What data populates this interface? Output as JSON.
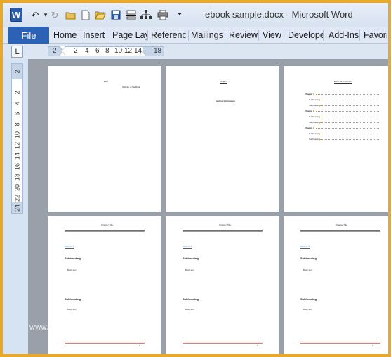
{
  "window": {
    "title": "ebook sample.docx  -  Microsoft Word",
    "app_icon_letter": "W",
    "accent_color": "#2c62b5",
    "border_color": "#e8a82a"
  },
  "quick_access": [
    {
      "name": "undo-icon",
      "glyph": "↶"
    },
    {
      "name": "undo-dropdown-icon",
      "glyph": "▾"
    },
    {
      "name": "redo-icon",
      "glyph": "↻"
    },
    {
      "name": "open-folder-icon",
      "glyph": "📂"
    },
    {
      "name": "new-document-icon",
      "glyph": "🗋"
    },
    {
      "name": "open-icon",
      "glyph": "📁"
    },
    {
      "name": "save-icon",
      "glyph": "💾"
    },
    {
      "name": "page-break-icon",
      "glyph": "▬"
    },
    {
      "name": "sitemap-icon",
      "glyph": "品"
    },
    {
      "name": "print-icon",
      "glyph": "🖶"
    },
    {
      "name": "customize-toolbar-icon",
      "glyph": "⏷"
    }
  ],
  "ribbon": {
    "file_label": "File",
    "tabs": [
      "Home",
      "Insert",
      "Page Lay",
      "Referenc",
      "Mailings",
      "Review",
      "View",
      "Develope",
      "Add-Ins",
      "Favori"
    ]
  },
  "ruler": {
    "tab_selector": "L",
    "h_numbers": [
      "2",
      "2",
      "4",
      "6",
      "8",
      "10",
      "12",
      "14",
      "18"
    ],
    "v_numbers": [
      "2",
      "2",
      "4",
      "6",
      "8",
      "10",
      "12",
      "14",
      "16",
      "18",
      "20",
      "22",
      "24"
    ]
  },
  "pages": {
    "p1": {
      "title": "Title",
      "subtitle": "Subtitle of the Book"
    },
    "p2": {
      "title": "Author",
      "subtitle": "Author Information"
    },
    "p3": {
      "title": "Table of Contents",
      "entries": [
        "Chapter 1",
        "Subheading",
        "Subheading",
        "Chapter 2",
        "Subheading",
        "Subheading",
        "Chapter 3",
        "Subheading",
        "Subheading"
      ]
    },
    "chapter_header": "Chapter Title",
    "chapter_links": [
      "Chapter 1",
      "Chapter 2",
      "Chapter 3"
    ],
    "subheading": "Subheading",
    "body_text": "Body text",
    "page_numbers": [
      "1",
      "2",
      "3"
    ]
  },
  "watermark": "www.heritagechristiancollege.com"
}
